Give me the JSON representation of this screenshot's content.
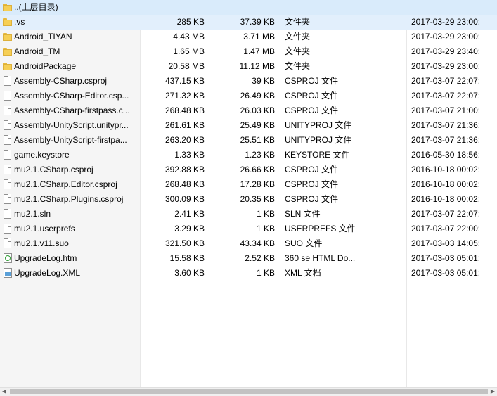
{
  "rows": [
    {
      "icon": "folder-icon",
      "name": "..(上层目录)",
      "size": "",
      "packed": "",
      "type": "",
      "date": ""
    },
    {
      "icon": "folder-icon",
      "name": ".vs",
      "size": "285 KB",
      "packed": "37.39 KB",
      "type": "文件夹",
      "date": "2017-03-29 23:00:"
    },
    {
      "icon": "folder-icon",
      "name": "Android_TIYAN",
      "size": "4.43 MB",
      "packed": "3.71 MB",
      "type": "文件夹",
      "date": "2017-03-29 23:00:"
    },
    {
      "icon": "folder-icon",
      "name": "Android_TM",
      "size": "1.65 MB",
      "packed": "1.47 MB",
      "type": "文件夹",
      "date": "2017-03-29 23:40:"
    },
    {
      "icon": "folder-icon",
      "name": "AndroidPackage",
      "size": "20.58 MB",
      "packed": "11.12 MB",
      "type": "文件夹",
      "date": "2017-03-29 23:00:"
    },
    {
      "icon": "file-icon",
      "name": "Assembly-CSharp.csproj",
      "size": "437.15 KB",
      "packed": "39 KB",
      "type": "CSPROJ 文件",
      "date": "2017-03-07 22:07:"
    },
    {
      "icon": "file-icon",
      "name": "Assembly-CSharp-Editor.csp...",
      "size": "271.32 KB",
      "packed": "26.49 KB",
      "type": "CSPROJ 文件",
      "date": "2017-03-07 22:07:"
    },
    {
      "icon": "file-icon",
      "name": "Assembly-CSharp-firstpass.c...",
      "size": "268.48 KB",
      "packed": "26.03 KB",
      "type": "CSPROJ 文件",
      "date": "2017-03-07 21:00:"
    },
    {
      "icon": "file-icon",
      "name": "Assembly-UnityScript.unitypr...",
      "size": "261.61 KB",
      "packed": "25.49 KB",
      "type": "UNITYPROJ 文件",
      "date": "2017-03-07 21:36:"
    },
    {
      "icon": "file-icon",
      "name": "Assembly-UnityScript-firstpa...",
      "size": "263.20 KB",
      "packed": "25.51 KB",
      "type": "UNITYPROJ 文件",
      "date": "2017-03-07 21:36:"
    },
    {
      "icon": "file-icon",
      "name": "game.keystore",
      "size": "1.33 KB",
      "packed": "1.23 KB",
      "type": "KEYSTORE 文件",
      "date": "2016-05-30 18:56:"
    },
    {
      "icon": "file-icon",
      "name": "mu2.1.CSharp.csproj",
      "size": "392.88 KB",
      "packed": "26.66 KB",
      "type": "CSPROJ 文件",
      "date": "2016-10-18 00:02:"
    },
    {
      "icon": "file-icon",
      "name": "mu2.1.CSharp.Editor.csproj",
      "size": "268.48 KB",
      "packed": "17.28 KB",
      "type": "CSPROJ 文件",
      "date": "2016-10-18 00:02:"
    },
    {
      "icon": "file-icon",
      "name": "mu2.1.CSharp.Plugins.csproj",
      "size": "300.09 KB",
      "packed": "20.35 KB",
      "type": "CSPROJ 文件",
      "date": "2016-10-18 00:02:"
    },
    {
      "icon": "file-icon",
      "name": "mu2.1.sln",
      "size": "2.41 KB",
      "packed": "1 KB",
      "type": "SLN 文件",
      "date": "2017-03-07 22:07:"
    },
    {
      "icon": "file-icon",
      "name": "mu2.1.userprefs",
      "size": "3.29 KB",
      "packed": "1 KB",
      "type": "USERPREFS 文件",
      "date": "2017-03-07 22:00:"
    },
    {
      "icon": "file-icon",
      "name": "mu2.1.v11.suo",
      "size": "321.50 KB",
      "packed": "43.34 KB",
      "type": "SUO 文件",
      "date": "2017-03-03 14:05:"
    },
    {
      "icon": "html-file-icon",
      "name": "UpgradeLog.htm",
      "size": "15.58 KB",
      "packed": "2.52 KB",
      "type": "360 se HTML Do...",
      "date": "2017-03-03 05:01:"
    },
    {
      "icon": "xml-file-icon",
      "name": "UpgradeLog.XML",
      "size": "3.60 KB",
      "packed": "1 KB",
      "type": "XML 文档",
      "date": "2017-03-03 05:01:"
    }
  ],
  "scrollbar": {
    "left_arrow": "◀",
    "right_arrow": "▶"
  },
  "colors": {
    "parent_row": "#d9ebfb",
    "selected_row": "#e2effc",
    "name_column_bg": "#f5f5f5",
    "folder": "#f6cf55"
  }
}
